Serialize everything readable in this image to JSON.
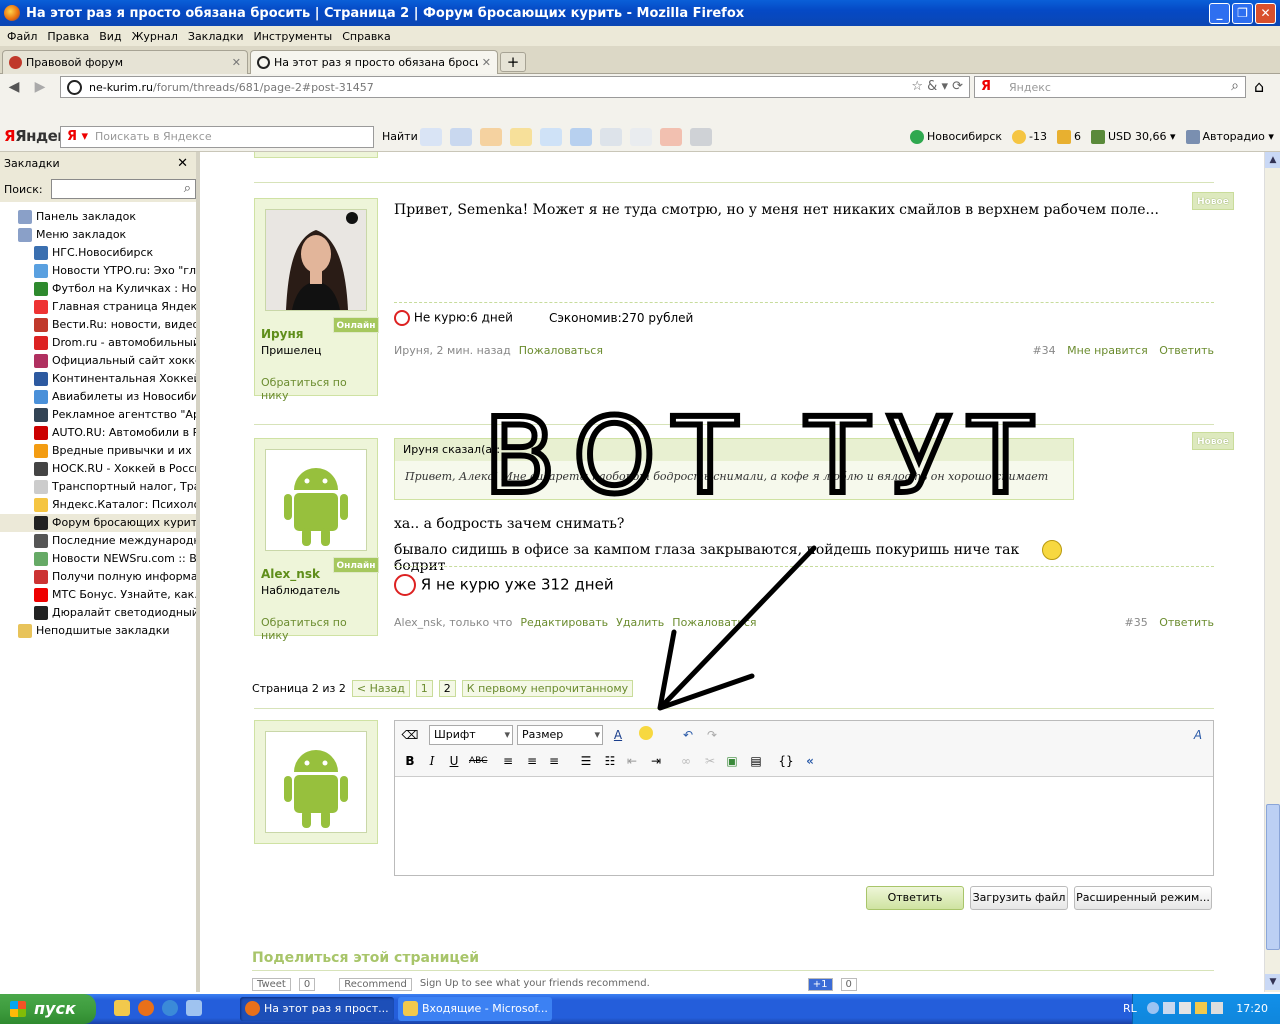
{
  "window": {
    "title": "На этот раз я просто обязана бросить | Страница 2 | Форум бросающих курить - Mozilla Firefox"
  },
  "menu": [
    "Файл",
    "Правка",
    "Вид",
    "Журнал",
    "Закладки",
    "Инструменты",
    "Справка"
  ],
  "tabs": [
    {
      "label": "Правовой форум"
    },
    {
      "label": "На этот раз я просто обязана бросить ..."
    }
  ],
  "nav": {
    "url_host": "ne-kurim.ru",
    "url_path": "/forum/threads/681/page-2#post-31457",
    "search_placeholder": "Яндекс"
  },
  "yandex_bar": {
    "brand": "Яндекс",
    "search_placeholder": "Поискать в Яндексе",
    "find_label": "Найти",
    "city": "Новосибирск",
    "temp": "-13",
    "traffic": "6",
    "usd": "USD 30,66",
    "radio": "Авторадио"
  },
  "sidebar": {
    "title": "Закладки",
    "search_label": "Поиск:",
    "items": [
      {
        "label": "Панель закладок",
        "indent": 1,
        "color": "#8aa0c8"
      },
      {
        "label": "Меню закладок",
        "indent": 1,
        "color": "#8aa0c8"
      },
      {
        "label": "НГС.Новосибирск",
        "indent": 2,
        "color": "#3a6fb0"
      },
      {
        "label": "Новости YTPO.ru: Эхо \"гл...",
        "indent": 2,
        "color": "#5aa0e0"
      },
      {
        "label": "Футбол на Куличках : Но...",
        "indent": 2,
        "color": "#2e8a2e"
      },
      {
        "label": "Главная страница Яндекса",
        "indent": 2,
        "color": "#e33"
      },
      {
        "label": "Вести.Ru: новости, видео...",
        "indent": 2,
        "color": "#c0392b"
      },
      {
        "label": "Drom.ru - автомобильный ...",
        "indent": 2,
        "color": "#d22"
      },
      {
        "label": "Официальный сайт хокке...",
        "indent": 2,
        "color": "#b03060"
      },
      {
        "label": "Континентальная Хоккей...",
        "indent": 2,
        "color": "#2d5aa0"
      },
      {
        "label": "Авиабилеты из Новосиби...",
        "indent": 2,
        "color": "#4a90d9"
      },
      {
        "label": "Рекламное агентство \"Ар...",
        "indent": 2,
        "color": "#345"
      },
      {
        "label": "AUTO.RU: Автомобили в Р...",
        "indent": 2,
        "color": "#c00"
      },
      {
        "label": "Вредные привычки и их п...",
        "indent": 2,
        "color": "#f39c12"
      },
      {
        "label": "HOCK.RU - Хоккей в Росси...",
        "indent": 2,
        "color": "#444"
      },
      {
        "label": "Транспортный налог, Тра...",
        "indent": 2,
        "color": "#ccc"
      },
      {
        "label": "Яндекс.Каталог: Психоло...",
        "indent": 2,
        "color": "#f5c542"
      },
      {
        "label": "Форум бросающих курить",
        "indent": 2,
        "color": "#222"
      },
      {
        "label": "Последние международн...",
        "indent": 2,
        "color": "#555"
      },
      {
        "label": "Новости NEWSru.com :: Вс...",
        "indent": 2,
        "color": "#6a6"
      },
      {
        "label": "Получи полную информац...",
        "indent": 2,
        "color": "#c33"
      },
      {
        "label": "МТС Бонус. Узнайте, как...",
        "indent": 2,
        "color": "#e00"
      },
      {
        "label": "Дюралайт светодиодный...",
        "indent": 2,
        "color": "#222"
      },
      {
        "label": "Неподшитые закладки",
        "indent": 1,
        "color": "#e8c35a"
      }
    ]
  },
  "post1": {
    "new_badge": "Новое",
    "online": "Онлайн",
    "username": "Ируня",
    "role": "Пришелец",
    "contact": "Обратиться по нику",
    "text": "Привет, Semenka! Может я не туда смотрю, но у меня нет никаких смайлов в верхнем рабочем поле...",
    "sig_days": "Не курю:6 дней",
    "sig_saved": "Сэкономив:270 рублей",
    "meta": "Ируня, 2 мин. назад",
    "report": "Пожаловаться",
    "number": "#34",
    "like": "Мне нравится",
    "reply": "Ответить"
  },
  "post2": {
    "new_badge": "Новое",
    "online": "Онлайн",
    "username": "Alex_nsk",
    "role": "Наблюдатель",
    "contact": "Обратиться по нику",
    "quote_head": "Ируня сказал(а):",
    "quote_text": "Привет, Алекс! Мне сигареты наоборот бодрость снимали, а кофе я люблю и вялость он хорошо снимает",
    "line1": "ха.. а бодрость зачем снимать?",
    "line2": "бывало сидишь в офисе за кампом глаза закрываются, пойдешь покуришь ниче так бодрит",
    "sig": "Я не курю уже 312 дней",
    "meta": "Alex_nsk, только что",
    "edit": "Редактировать",
    "delete": "Удалить",
    "report": "Пожаловаться",
    "number": "#35",
    "reply": "Ответить"
  },
  "pager": {
    "label": "Страница 2 из 2",
    "prev": "< Назад",
    "p1": "1",
    "p2": "2",
    "first_unread": "К первому непрочитанному"
  },
  "editor": {
    "font_label": "Шрифт",
    "size_label": "Размер",
    "reply_btn": "Ответить",
    "upload_btn": "Загрузить файл",
    "advanced_btn": "Расширенный режим..."
  },
  "share": {
    "title": "Поделиться этой страницей",
    "tweet": "Tweet",
    "tweet_count": "0",
    "recommend": "Recommend",
    "fb_text": "Sign Up to see what your friends recommend.",
    "gplus": "+1",
    "gplus_count": "0"
  },
  "annotation": {
    "text": "ВОТ ТУТ"
  },
  "taskbar": {
    "start": "пуск",
    "task1": "На этот раз я прост...",
    "task2": "Входящие - Microsof...",
    "lang": "RL",
    "time": "17:20"
  }
}
